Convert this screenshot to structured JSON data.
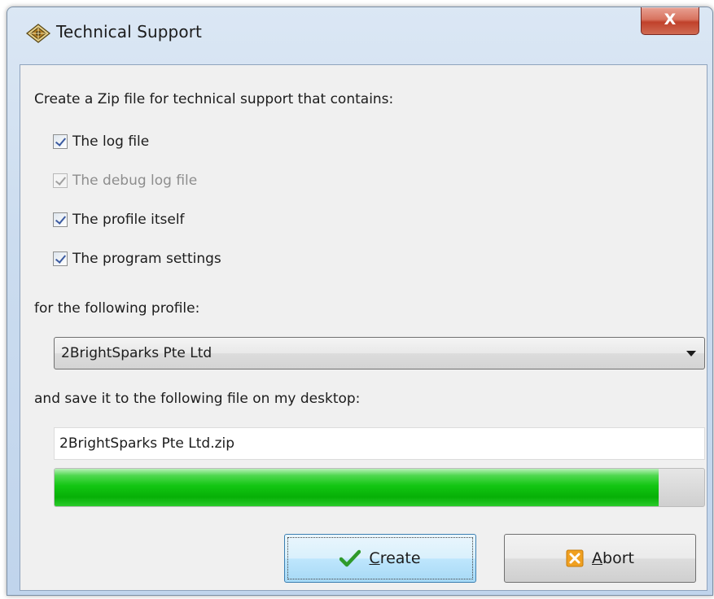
{
  "window": {
    "title": "Technical Support",
    "close_label": "X"
  },
  "intro": "Create a Zip file for technical support that contains:",
  "options": [
    {
      "label": "The log file",
      "checked": true,
      "enabled": true
    },
    {
      "label": "The debug log file",
      "checked": true,
      "enabled": false
    },
    {
      "label": "The profile itself",
      "checked": true,
      "enabled": true
    },
    {
      "label": "The program settings",
      "checked": true,
      "enabled": true
    }
  ],
  "profile": {
    "label": "for the following profile:",
    "selected": "2BrightSparks Pte Ltd"
  },
  "save": {
    "label": "and save it to the following file on my desktop:",
    "filename": "2BrightSparks Pte Ltd.zip"
  },
  "progress": {
    "fraction": 0.93
  },
  "buttons": {
    "create": {
      "mnemonic": "C",
      "rest": "reate"
    },
    "abort": {
      "mnemonic": "A",
      "rest": "bort"
    }
  },
  "colors": {
    "progress_green": "#13c613",
    "close_red": "#c0412b",
    "dialog_bg": "#f0f0f0"
  }
}
